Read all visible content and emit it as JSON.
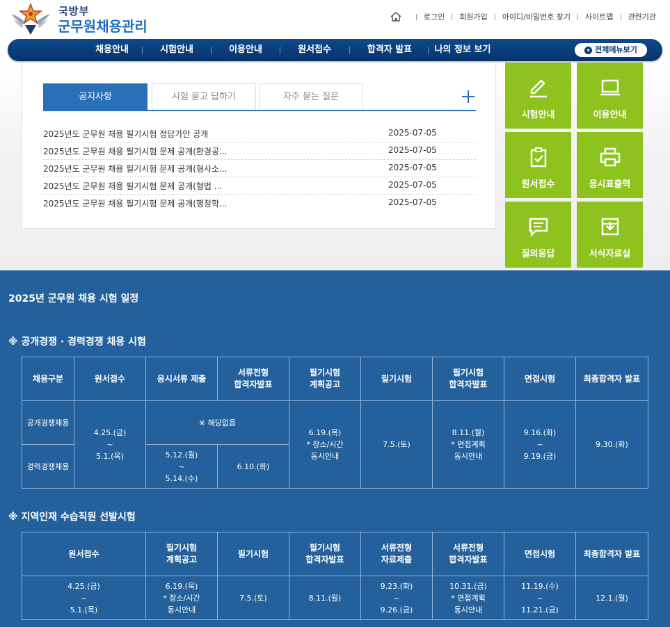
{
  "header": {
    "logo_small": "국방부",
    "logo_big": "군무원채용관리",
    "util_links": [
      "로그인",
      "회원가입",
      "아이디/비밀번호 찾기",
      "사이트맵",
      "관련기관"
    ]
  },
  "gnb": {
    "items": [
      "채용안내",
      "시험안내",
      "이용안내",
      "원서접수",
      "합격자 발표",
      "나의 정보 보기"
    ],
    "all_menu": "전체메뉴보기"
  },
  "notice": {
    "tabs": [
      "공지사항",
      "시험 묻고 답하기",
      "자주 묻는 질문"
    ],
    "rows": [
      {
        "title": "2025년도 군무원 채용 필기시험 정답가안 공개",
        "date": "2025-07-05"
      },
      {
        "title": "2025년도 군무원 채용 필기시험 문제 공개(환경공...",
        "date": "2025-07-05"
      },
      {
        "title": "2025년도 군무원 채용 필기시험 문제 공개(형사소...",
        "date": "2025-07-05"
      },
      {
        "title": "2025년도 군무원 채용 필기시험 문제 공개(형법 ...",
        "date": "2025-07-05"
      },
      {
        "title": "2025년도 군무원 채용 필기시험 문제 공개(행정학...",
        "date": "2025-07-05"
      }
    ]
  },
  "quick": {
    "tiles": [
      {
        "label": "시험안내",
        "icon": "pencil-icon"
      },
      {
        "label": "이용안내",
        "icon": "laptop-icon"
      },
      {
        "label": "원서접수",
        "icon": "clipboard-check-icon"
      },
      {
        "label": "응시표출력",
        "icon": "printer-icon"
      },
      {
        "label": "질의응답",
        "icon": "chat-icon"
      },
      {
        "label": "서식자료실",
        "icon": "download-box-icon"
      }
    ]
  },
  "schedule": {
    "title": "2025년 군무원 채용 시험 일정",
    "open": {
      "subtitle": "※ 공개경쟁 · 경력경쟁 채용 시험",
      "headers": [
        "채용구분",
        "원서접수",
        "응시서류 제출",
        "서류전형\n합격자발표",
        "필기시험\n계획공고",
        "필기시험",
        "필기시험\n합격자발표",
        "면접시험",
        "최종합격자 발표"
      ],
      "row_open": "공개경쟁채용",
      "row_career": "경력경쟁채용",
      "apply": "4.25.(금)\n~\n5.1.(목)",
      "none": "※ 해당없음",
      "docs": "5.12.(월)\n~\n5.14.(수)",
      "doc_pass": "6.10.(화)",
      "plan": "6.19.(목)\n* 장소/시간\n동시안내",
      "exam": "7.5.(토)",
      "exam_pass": "8.11.(월)\n* 면접계획\n동시안내",
      "interview": "9.16.(화)\n~\n9.19.(금)",
      "final": "9.30.(화)"
    },
    "local": {
      "subtitle": "※ 지역인재 수습직원 선발시험",
      "headers": [
        "원서접수",
        "필기시험\n계획공고",
        "필기시험",
        "필기시험\n합격자발표",
        "서류전형\n자료제출",
        "서류전형\n합격자발표",
        "면접시험",
        "최종합격자 발표"
      ],
      "cells": [
        "4.25.(금)\n~\n5.1.(목)",
        "6.19.(목)\n* 장소/시간\n동시안내",
        "7.5.(토)",
        "8.11.(월)",
        "9.23.(화)\n~\n9.26.(금)",
        "10.31.(금)\n* 면접계획\n동시안내",
        "11.19.(수)\n~\n11.21.(금)",
        "12.1.(월)"
      ]
    }
  },
  "colors": {
    "navy": "#0b3b73",
    "accent_blue": "#2a70b8",
    "tile_green": "#8dc21f",
    "schedule_bg": "#24619c"
  }
}
